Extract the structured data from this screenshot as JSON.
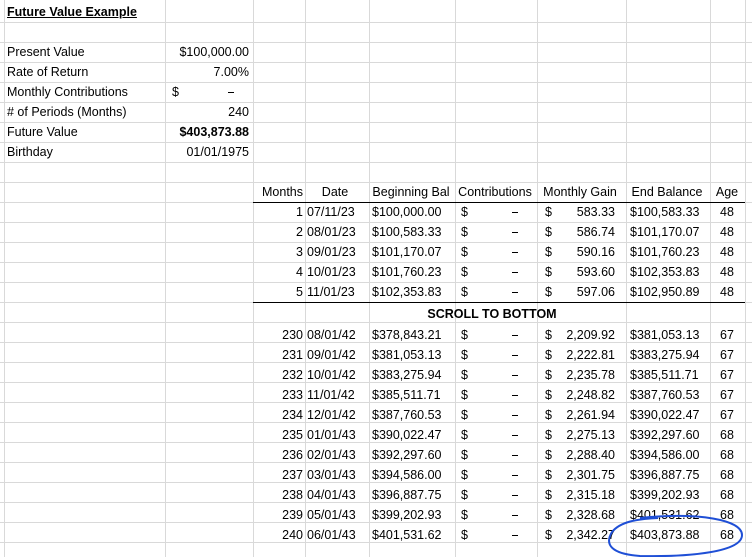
{
  "title": "Future Value Example",
  "params": [
    {
      "label": "Present Value",
      "value": "$100,000.00",
      "bold": false
    },
    {
      "label": "Rate of Return",
      "value": "7.00%",
      "bold": false
    },
    {
      "label": "Monthly Contributions",
      "value": "$",
      "bold": false,
      "dash": true
    },
    {
      "label": "# of Periods (Months)",
      "value": "240",
      "bold": false
    },
    {
      "label": "Future Value",
      "value": "$403,873.88",
      "bold": true
    },
    {
      "label": "Birthday",
      "value": "01/01/1975",
      "bold": false
    }
  ],
  "table": {
    "headers": [
      "Months",
      "Date",
      "Beginning Bal",
      "Contributions",
      "Monthly Gain",
      "End Balance",
      "Age"
    ],
    "rows_top": [
      [
        "1",
        "07/11/23",
        "$100,000.00",
        "$",
        "$",
        "583.33",
        "$100,583.33",
        "48"
      ],
      [
        "2",
        "08/01/23",
        "$100,583.33",
        "$",
        "$",
        "586.74",
        "$101,170.07",
        "48"
      ],
      [
        "3",
        "09/01/23",
        "$101,170.07",
        "$",
        "$",
        "590.16",
        "$101,760.23",
        "48"
      ],
      [
        "4",
        "10/01/23",
        "$101,760.23",
        "$",
        "$",
        "593.60",
        "$102,353.83",
        "48"
      ],
      [
        "5",
        "11/01/23",
        "$102,353.83",
        "$",
        "$",
        "597.06",
        "$102,950.89",
        "48"
      ]
    ],
    "scroll_note": "SCROLL TO BOTTOM",
    "rows_bottom": [
      [
        "230",
        "08/01/42",
        "$378,843.21",
        "$",
        "$",
        "2,209.92",
        "$381,053.13",
        "67"
      ],
      [
        "231",
        "09/01/42",
        "$381,053.13",
        "$",
        "$",
        "2,222.81",
        "$383,275.94",
        "67"
      ],
      [
        "232",
        "10/01/42",
        "$383,275.94",
        "$",
        "$",
        "2,235.78",
        "$385,511.71",
        "67"
      ],
      [
        "233",
        "11/01/42",
        "$385,511.71",
        "$",
        "$",
        "2,248.82",
        "$387,760.53",
        "67"
      ],
      [
        "234",
        "12/01/42",
        "$387,760.53",
        "$",
        "$",
        "2,261.94",
        "$390,022.47",
        "67"
      ],
      [
        "235",
        "01/01/43",
        "$390,022.47",
        "$",
        "$",
        "2,275.13",
        "$392,297.60",
        "68"
      ],
      [
        "236",
        "02/01/43",
        "$392,297.60",
        "$",
        "$",
        "2,288.40",
        "$394,586.00",
        "68"
      ],
      [
        "237",
        "03/01/43",
        "$394,586.00",
        "$",
        "$",
        "2,301.75",
        "$396,887.75",
        "68"
      ],
      [
        "238",
        "04/01/43",
        "$396,887.75",
        "$",
        "$",
        "2,315.18",
        "$399,202.93",
        "68"
      ],
      [
        "239",
        "05/01/43",
        "$399,202.93",
        "$",
        "$",
        "2,328.68",
        "$401,531.62",
        "68"
      ],
      [
        "240",
        "06/01/43",
        "$401,531.62",
        "$",
        "$",
        "2,342.27",
        "$403,873.88",
        "68"
      ]
    ]
  },
  "colors": {
    "gridline": "#d9d9d9",
    "circle": "#1f4fd6"
  }
}
